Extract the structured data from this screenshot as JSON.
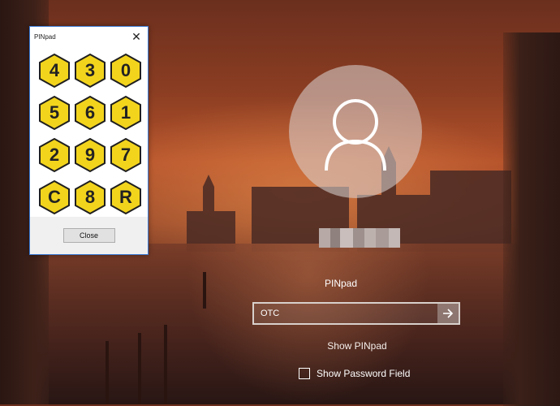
{
  "pinpad_window": {
    "title": "PINpad",
    "close_glyph": "✕",
    "close_button_label": "Close",
    "keys": [
      "4",
      "3",
      "0",
      "5",
      "6",
      "1",
      "2",
      "9",
      "7",
      "C",
      "8",
      "R"
    ],
    "key_color": "#f3d41d",
    "key_border_color": "#1f1f1f"
  },
  "login": {
    "credential_provider_label": "PINpad",
    "password_value": "OTC",
    "submit_icon": "arrow-right-icon",
    "show_pinpad_link": "Show PINpad",
    "show_password_label": "Show Password Field",
    "show_password_checked": false
  },
  "colors": {
    "window_border": "#3b7bd6",
    "text_on_background": "#ffffff"
  }
}
